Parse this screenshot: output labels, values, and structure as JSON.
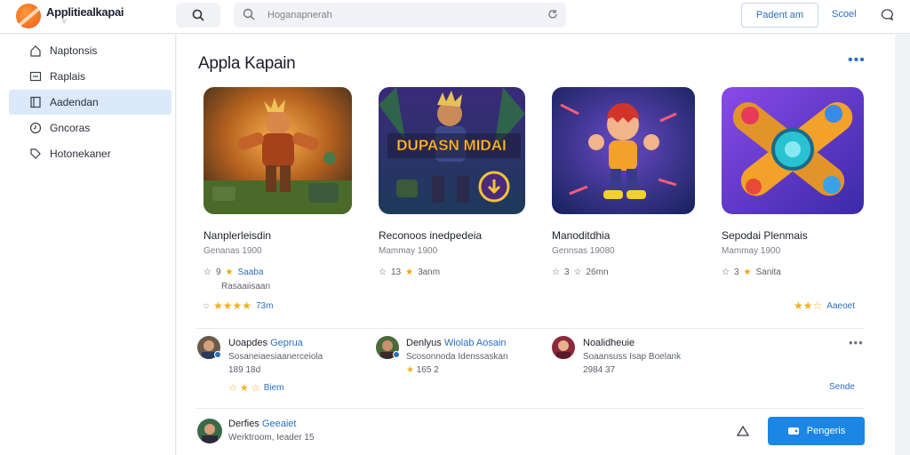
{
  "header": {
    "app_name": "Applitiealkapai",
    "app_sub": "V",
    "search_placeholder": "Hoganapnerah",
    "outline_button": "Padent am",
    "link": "Scoel"
  },
  "sidebar": {
    "items": [
      {
        "label": "Naptonsis",
        "icon": "home-icon"
      },
      {
        "label": "Raplais",
        "icon": "list-icon"
      },
      {
        "label": "Aadendan",
        "icon": "book-icon",
        "active": true
      },
      {
        "label": "Gncoras",
        "icon": "clock-icon"
      },
      {
        "label": "Hotonekaner",
        "icon": "tag-icon"
      }
    ]
  },
  "main": {
    "title": "Appla Kapain",
    "more": "•••",
    "cards": [
      {
        "title": "Nanplerleisdin",
        "sub": "Genanas 1900",
        "meta_left": "9",
        "meta_blue": "Saaba",
        "extra": "Rasaaiisaan",
        "rating_label": "73m",
        "art_text": ""
      },
      {
        "title": "Reconoos inedpedeia",
        "sub": "Mammay 1900",
        "meta_left": "13",
        "meta_right": "3anm",
        "art_text": "DUPASN MIDAI"
      },
      {
        "title": "Manoditdhia",
        "sub": "Gennsas 19080",
        "meta_left": "3",
        "meta_right": "26mn"
      },
      {
        "title": "Sepodai Plenmais",
        "sub": "Mammay 1900",
        "meta_left": "3",
        "meta_right": "Sanita"
      }
    ],
    "card4_rating_link": "Aaeoet"
  },
  "reviews": [
    {
      "name": "Uoapdes",
      "name_blue": "Geprua",
      "text": "Sosaneiaesiaanerceiola",
      "sub": "189 18d",
      "rating_label": "Biem"
    },
    {
      "name": "Denlyus",
      "name_blue": "Wiolab Aosain",
      "text": "Scosonnoda Idenssaskan",
      "sub": "165 2"
    },
    {
      "name": "Noalidheuie",
      "text": "Soaansuss Isap Boelank",
      "sub": "2984 37"
    }
  ],
  "reviews_more": "•••",
  "reviews_link": "Sende",
  "footer_review": {
    "name": "Derfies",
    "name_blue": "Geeaiet",
    "text": "Werktroom, Ieader 15"
  },
  "primary_button": "Pengeris"
}
